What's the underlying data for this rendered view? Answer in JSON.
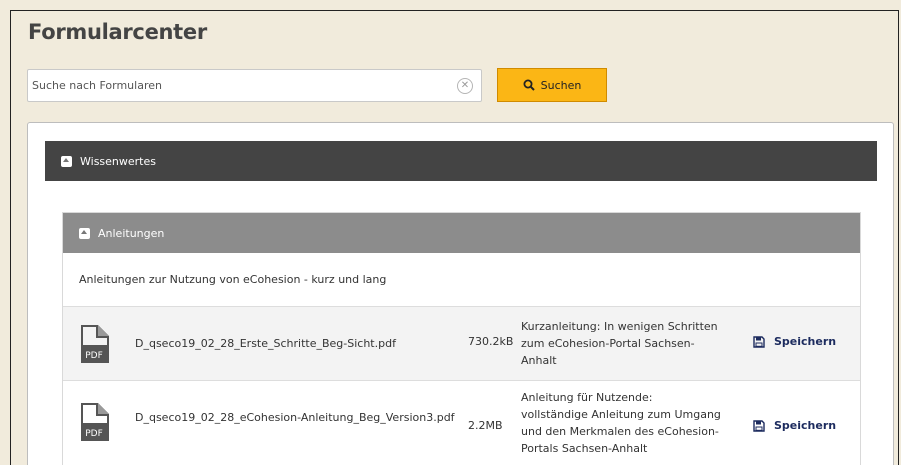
{
  "header": {
    "title": "Formularcenter"
  },
  "search": {
    "placeholder": "Suche nach Formularen",
    "button_label": "Suchen"
  },
  "section": {
    "title": "Wissenwertes"
  },
  "subsection": {
    "title": "Anleitungen",
    "description": "Anleitungen zur Nutzung von eCohesion - kurz und lang"
  },
  "files": [
    {
      "icon_label": "PDF",
      "name": "D_qseco19_02_28_Erste_Schritte_Beg-Sicht.pdf",
      "size": "730.2kB",
      "description": "Kurzanleitung: In wenigen Schritten zum eCohesion-Portal Sachsen-Anhalt",
      "action": "Speichern"
    },
    {
      "icon_label": "PDF",
      "name": "D_qseco19_02_28_eCohesion-Anleitung_Beg_Version3.pdf",
      "size": "2.2MB",
      "description": "Anleitung für Nutzende: vollständige Anleitung zum Umgang und den Merkmalen des eCohesion-Portals Sachsen-Anhalt",
      "action": "Speichern"
    }
  ],
  "colors": {
    "page_background": "#f1ebdc",
    "accent": "#fbb615",
    "section_header": "#444444",
    "subsection_header": "#8c8c8c",
    "link": "#1c2b5e"
  },
  "icons": {
    "clear": "clear-icon",
    "search": "search-icon",
    "toggle": "collapse-icon",
    "file": "pdf-file-icon",
    "save": "floppy-disk-icon"
  }
}
